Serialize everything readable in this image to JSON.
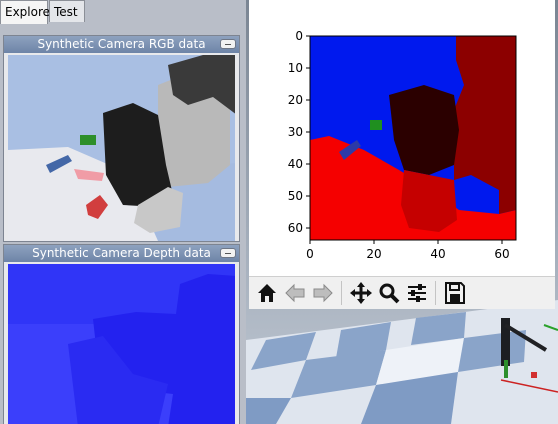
{
  "tabs": [
    "Explorer",
    "Test"
  ],
  "rgb_panel": {
    "title": "Synthetic Camera RGB data"
  },
  "depth_panel": {
    "title": "Synthetic Camera Depth data"
  },
  "plot": {
    "xticks": [
      "0",
      "20",
      "40",
      "60"
    ],
    "yticks": [
      "0",
      "10",
      "20",
      "30",
      "40",
      "50",
      "60"
    ]
  },
  "toolbar": {
    "icons": [
      "home-icon",
      "back-arrow-icon",
      "forward-arrow-icon",
      "pan-icon",
      "zoom-icon",
      "configure-subplots-icon",
      "save-icon"
    ]
  },
  "colors": {
    "title_bar": "#7a90b1",
    "depth_blue": "#2f3bf7",
    "plot_blue": "#0019ee",
    "plot_red": "#f50000"
  }
}
